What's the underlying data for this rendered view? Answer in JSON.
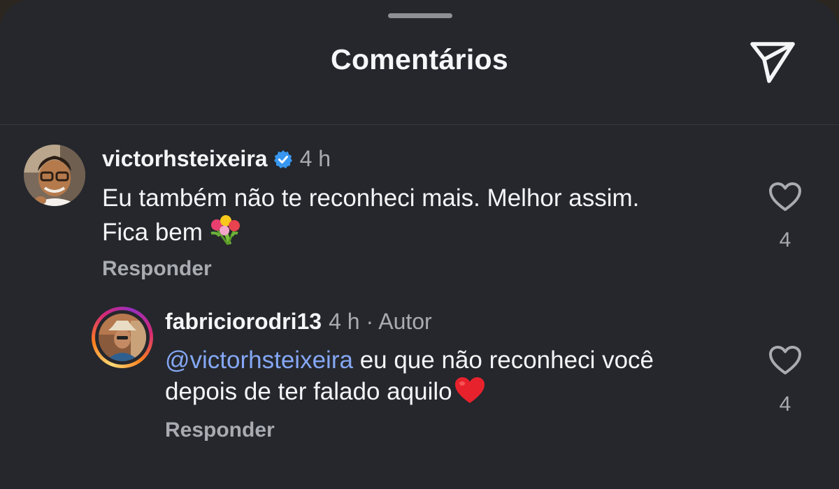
{
  "header": {
    "title": "Comentários",
    "share_icon": "paper-plane-icon"
  },
  "comments": [
    {
      "username": "victorhsteixeira",
      "verified": true,
      "time": "4 h",
      "text_line1": "Eu também não te reconheci mais. Melhor assim.",
      "text_line2": "Fica bem",
      "emoji": "bouquet-emoji",
      "reply_label": "Responder",
      "likes": "4",
      "like_icon": "heart-outline-icon"
    },
    {
      "username": "fabriciorodri13",
      "time": "4 h",
      "author_label": "· Autor",
      "has_story_ring": true,
      "mention": "@victorhsteixeira",
      "text_line1_rest": "eu que não reconheci você",
      "text_line2": "depois de ter falado aquilo",
      "emoji": "red-heart-emoji",
      "reply_label": "Responder",
      "likes": "4",
      "like_icon": "heart-outline-icon"
    }
  ],
  "colors": {
    "sheet_background": "#25272c",
    "text_primary": "#f3f5f7",
    "text_secondary": "#a8abb1",
    "mention": "#85a7f4",
    "verified_badge": "#3897f0"
  }
}
